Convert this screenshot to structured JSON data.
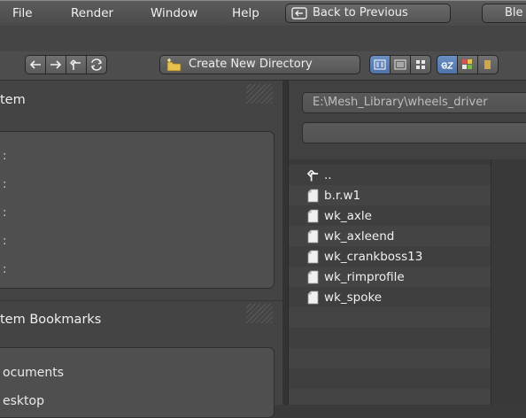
{
  "menubar": {
    "items": [
      "File",
      "Render",
      "Window",
      "Help"
    ],
    "back_label": "Back to Previous",
    "screen_label": "Ble"
  },
  "toolbar": {
    "create_dir_label": "Create New Directory"
  },
  "left_panel": {
    "system_header": "tem",
    "system_colons": [
      ":",
      ":",
      ":",
      ":",
      ":"
    ],
    "bookmarks_header": "tem Bookmarks",
    "bookmarks": [
      "ocuments",
      "esktop"
    ]
  },
  "path_bar": {
    "directory": "E:\\Mesh_Library\\wheels_driver",
    "filename": ""
  },
  "files": {
    "parent": "..",
    "items": [
      "b.r.w1",
      "wk_axle",
      "wk_axleend",
      "wk_crankboss13",
      "wk_rimprofile",
      "wk_spoke"
    ]
  },
  "colors": {
    "accent": "#5b7fb8",
    "folder_yellow": "#e6c14d"
  }
}
